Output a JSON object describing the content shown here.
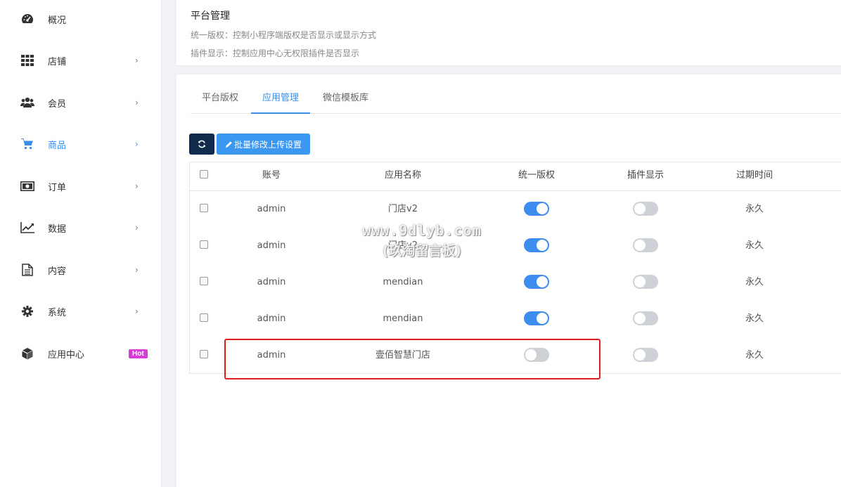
{
  "sidebar": {
    "items": [
      {
        "label": "概况",
        "icon": "dashboard-icon",
        "has_chevron": false
      },
      {
        "label": "店铺",
        "icon": "grid-icon",
        "has_chevron": true
      },
      {
        "label": "会员",
        "icon": "users-icon",
        "has_chevron": true
      },
      {
        "label": "商品",
        "icon": "cart-icon",
        "has_chevron": true,
        "active": true
      },
      {
        "label": "订单",
        "icon": "money-icon",
        "has_chevron": true
      },
      {
        "label": "数据",
        "icon": "line-chart-icon",
        "has_chevron": true
      },
      {
        "label": "内容",
        "icon": "document-icon",
        "has_chevron": true
      },
      {
        "label": "系统",
        "icon": "gear-icon",
        "has_chevron": true
      },
      {
        "label": "应用中心",
        "icon": "cube-icon",
        "badge": "Hot"
      }
    ],
    "chevron": "›",
    "accent": "#3a8ee6"
  },
  "info": {
    "title": "平台管理",
    "line1": "统一版权：控制小程序端版权是否显示或显示方式",
    "line2": "插件显示：控制应用中心无权限插件是否显示"
  },
  "tabs": [
    {
      "label": "平台版权",
      "active": false
    },
    {
      "label": "应用管理",
      "active": true
    },
    {
      "label": "微信模板库",
      "active": false
    }
  ],
  "toolbar": {
    "refresh_icon": "refresh-icon",
    "batch_label": "批量修改上传设置"
  },
  "table": {
    "headers": [
      "账号",
      "应用名称",
      "统一版权",
      "插件显示",
      "过期时间"
    ],
    "rows": [
      {
        "account": "admin",
        "app": "门店v2",
        "copyright": true,
        "plugin": false,
        "expire": "永久"
      },
      {
        "account": "admin",
        "app": "门店v2",
        "copyright": true,
        "plugin": false,
        "expire": "永久"
      },
      {
        "account": "admin",
        "app": "mendian",
        "copyright": true,
        "plugin": false,
        "expire": "永久"
      },
      {
        "account": "admin",
        "app": "mendian",
        "copyright": true,
        "plugin": false,
        "expire": "永久"
      },
      {
        "account": "admin",
        "app": "壹佰智慧门店",
        "copyright": false,
        "plugin": false,
        "expire": "永久"
      }
    ]
  },
  "watermark": {
    "line1": "www.9dlyb.com",
    "line2": "(玖淘留言板)"
  },
  "colors": {
    "switch_on": "#3c8dee",
    "switch_off": "#ced2d6",
    "refresh_button": "#0f2a4a",
    "batch_button": "#3c97f0",
    "highlight": "#e01e1e",
    "hot_badge": "#d63dd6"
  }
}
